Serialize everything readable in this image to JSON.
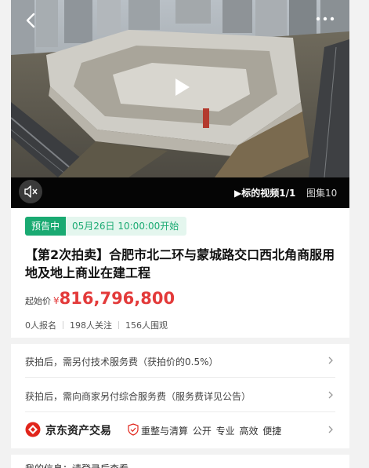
{
  "media": {
    "video_tab": "▶标的视频1/1",
    "gallery_tab": "图集10"
  },
  "auction": {
    "status": "预告中",
    "start_time": "05月26日 10:00:00开始",
    "title": "【第2次拍卖】合肥市北二环与蒙城路交口西北角商服用地及地上商业在建工程",
    "price_label": "起始价",
    "price_symbol": "¥",
    "price": "816,796,800",
    "stats": {
      "registrations": "0人报名",
      "followers": "198人关注",
      "viewers": "156人围观"
    }
  },
  "fees": {
    "tech_fee": "获拍后，需另付技术服务费（获拍价的0.5%）",
    "service_fee": "获拍后，需向商家另付综合服务费（服务费详见公告）",
    "platform": {
      "name": "京东资产交易",
      "tags": "重整与清算 公开 专业 高效 便捷"
    }
  },
  "my_info": {
    "text": "我的信息：请登录后查看"
  },
  "colors": {
    "accent_green": "#1aaa72",
    "price_red": "#e33a3a",
    "jd_red": "#e1251b"
  }
}
